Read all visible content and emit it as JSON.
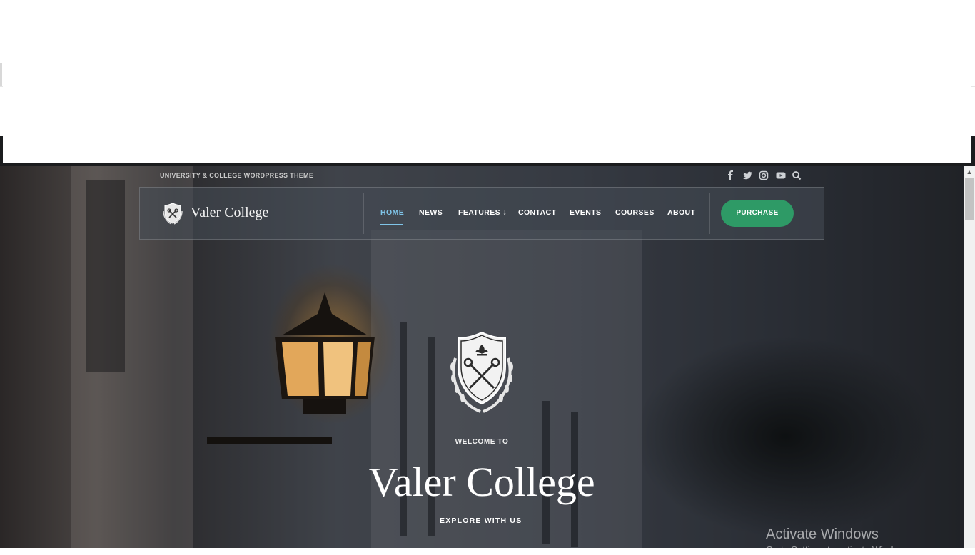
{
  "topbar": {
    "tagline": "UNIVERSITY & COLLEGE WORDPRESS THEME",
    "social_icons": [
      "facebook-icon",
      "twitter-icon",
      "instagram-icon",
      "youtube-icon",
      "search-icon"
    ]
  },
  "brand": {
    "name": "Valer College"
  },
  "nav": {
    "items": [
      {
        "label": "HOME",
        "active": true
      },
      {
        "label": "NEWS"
      },
      {
        "label": "FEATURES ↓"
      },
      {
        "label": "CONTACT"
      },
      {
        "label": "EVENTS"
      },
      {
        "label": "COURSES"
      },
      {
        "label": "ABOUT"
      }
    ],
    "purchase_label": "PURCHASE"
  },
  "hero": {
    "welcome": "WELCOME TO",
    "title": "Valer College",
    "cta": "EXPLORE WITH US"
  },
  "watermark": {
    "title": "Activate Windows",
    "subtitle": "Go to Settings to activate Windows."
  },
  "colors": {
    "accent_active": "#7fc4e8",
    "purchase_bg": "#2e9a66"
  }
}
